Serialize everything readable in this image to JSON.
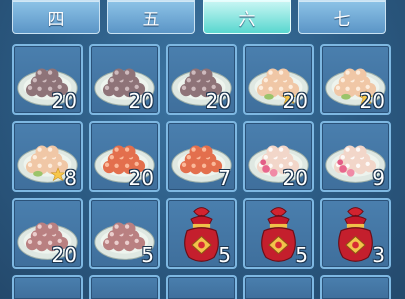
{
  "tabs": [
    {
      "label": "四"
    },
    {
      "label": "五"
    },
    {
      "label": "六",
      "active": true
    },
    {
      "label": "七"
    }
  ],
  "rows": [
    [
      {
        "item": "taro-balls-dark",
        "qty": "20"
      },
      {
        "item": "taro-balls-dark",
        "qty": "20"
      },
      {
        "item": "taro-balls-dark",
        "qty": "20"
      },
      {
        "item": "star-rice-balls",
        "qty": "20"
      },
      {
        "item": "star-rice-balls",
        "qty": "20"
      }
    ],
    [
      {
        "item": "star-rice-balls",
        "qty": "8"
      },
      {
        "item": "red-rice-balls",
        "qty": "20"
      },
      {
        "item": "red-rice-balls",
        "qty": "7"
      },
      {
        "item": "flower-rice-balls",
        "qty": "20"
      },
      {
        "item": "flower-rice-balls",
        "qty": "9"
      }
    ],
    [
      {
        "item": "pink-rice-balls",
        "qty": "20"
      },
      {
        "item": "pink-rice-balls",
        "qty": "5"
      },
      {
        "item": "lucky-bag",
        "qty": "5"
      },
      {
        "item": "lucky-bag",
        "qty": "5"
      },
      {
        "item": "lucky-bag",
        "qty": "3"
      }
    ]
  ]
}
